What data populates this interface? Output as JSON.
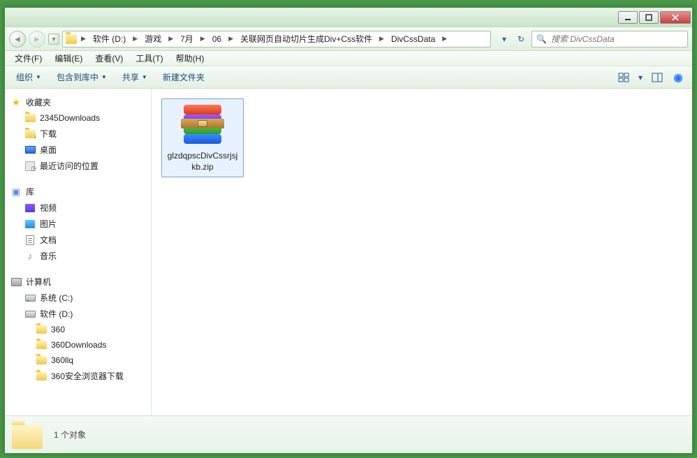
{
  "breadcrumb": [
    {
      "label": "软件 (D:)"
    },
    {
      "label": "游戏"
    },
    {
      "label": "7月"
    },
    {
      "label": "06"
    },
    {
      "label": "关联网页自动切片生成Div+Css软件"
    },
    {
      "label": "DivCssData"
    }
  ],
  "search": {
    "placeholder": "搜索 DivCssData"
  },
  "menu": {
    "file": "文件(F)",
    "edit": "编辑(E)",
    "view": "查看(V)",
    "tools": "工具(T)",
    "help": "帮助(H)"
  },
  "toolbar": {
    "organize": "组织",
    "include": "包含到库中",
    "share": "共享",
    "newfolder": "新建文件夹"
  },
  "sidebar": {
    "favorites": {
      "header": "收藏夹",
      "items": [
        {
          "label": "2345Downloads",
          "icon": "folder"
        },
        {
          "label": "下载",
          "icon": "folder-dl"
        },
        {
          "label": "桌面",
          "icon": "desktop"
        },
        {
          "label": "最近访问的位置",
          "icon": "recent"
        }
      ]
    },
    "libraries": {
      "header": "库",
      "items": [
        {
          "label": "视频",
          "icon": "video"
        },
        {
          "label": "图片",
          "icon": "pic"
        },
        {
          "label": "文档",
          "icon": "doc"
        },
        {
          "label": "音乐",
          "icon": "music"
        }
      ]
    },
    "computer": {
      "header": "计算机",
      "items": [
        {
          "label": "系统 (C:)",
          "icon": "drive-c",
          "children": []
        },
        {
          "label": "软件 (D:)",
          "icon": "drive",
          "children": [
            {
              "label": "360"
            },
            {
              "label": "360Downloads"
            },
            {
              "label": "360llq"
            },
            {
              "label": "360安全浏览器下载"
            }
          ]
        }
      ]
    }
  },
  "files": [
    {
      "name": "glzdqpscDivCssrjsjkb.zip",
      "type": "zip"
    }
  ],
  "status": {
    "text": "1 个对象"
  }
}
